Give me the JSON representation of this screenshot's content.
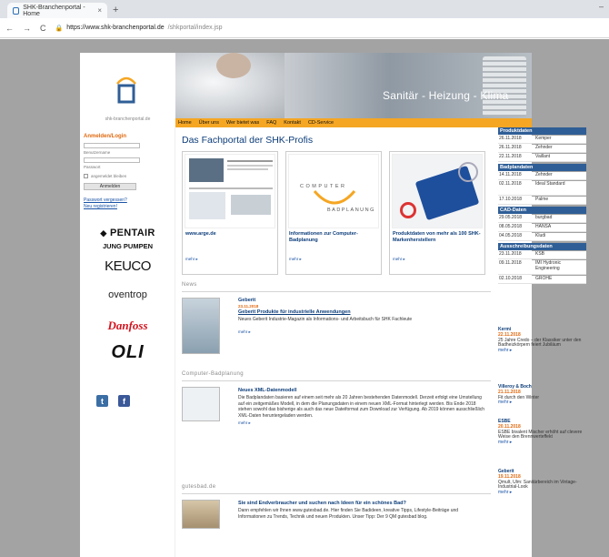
{
  "browser": {
    "tab_title": "SHK-Branchenportal - Home",
    "tab_close": "×",
    "new_tab": "+",
    "url_host": "https://www.shk-branchenportal.de",
    "url_path": "/shkportal/index.jsp",
    "window_controls": "–"
  },
  "site": {
    "logo_text": "shk-branchenportal.de",
    "banner_text": "Sanitär - Heizung - Klima",
    "nav": [
      "Home",
      "Über uns",
      "Wer bietet was",
      "FAQ",
      "Kontakt",
      "CD-Service"
    ]
  },
  "login": {
    "title": "Anmelden/Login",
    "username_label": "Benutzername",
    "password_label": "Passwort",
    "remember_label": "angemeldet bleiben",
    "button": "Anmelden",
    "forgot": "Passwort vergessen?",
    "register": "Neu registrieren!"
  },
  "brands": {
    "pentair": "PENTAIR",
    "jung": "JUNG PUMPEN",
    "keuco": "KEUCO",
    "oventrop": "oventrop",
    "danfoss": "Danfoss",
    "oli": "OLI"
  },
  "social": {
    "tumblr": "t",
    "facebook": "f"
  },
  "main": {
    "title": "Das Fachportal der SHK-Profis",
    "cards": [
      {
        "title": "www.arge.de",
        "more": "mehr ▸"
      },
      {
        "title": "Informationen zur Computer-Badplanung",
        "more": "mehr ▸",
        "logo_top": "COMPUTER",
        "logo_bottom": "BADPLANUNG"
      },
      {
        "title": "Produktdaten von mehr als 100 SHK-Markenherstellern",
        "more": "mehr ▸"
      }
    ],
    "sections": {
      "news": "News",
      "computer": "Computer-Badplanung",
      "gutesbad": "gutesbad.de"
    },
    "news1": {
      "head": "Geberit",
      "date": "23.11.2018",
      "title": "Geberit Produkte für industrielle Anwendungen",
      "text": "Neues Geberit Industrie-Magazin als Informations- und Arbeitsbuch für SHK Fachleute",
      "more": "mehr ▸"
    },
    "news2": {
      "title": "Neues XML-Datenmodell",
      "text": "Die Badplandaten basieren auf einem seit mehr als 20 Jahren bestehenden Datenmodell. Derzeit erfolgt eine Umstellung auf ein zeitgemäßes Modell, in dem die Planungsdaten in einem neuen XML-Format hinterlegt werden. Bis Ende 2018 stehen sowohl das bisherige als auch das neue Dateiformat zum Download zur Verfügung. Ab 2019 können ausschließlich XML-Daten heruntergeladen werden.",
      "more": "mehr ▸"
    },
    "news3": {
      "title": "Sie sind Endverbraucher und suchen nach Ideen für ein schönes Bad?",
      "text": "Dann empfehlen wir Ihnen www.gutesbad.de. Hier finden Sie Badideen, kreative Tipps, Lifestyle-Beiträge und Informationen zu Trends, Technik und neuen Produkten. Unser Tipp: Der 9 QM gutesbad blog."
    }
  },
  "right": {
    "produktdaten": {
      "title": "Produktdaten",
      "rows": [
        {
          "date": "26.11.2018",
          "name": "Kemper"
        },
        {
          "date": "26.11.2018",
          "name": "Zehnder"
        },
        {
          "date": "22.11.2018",
          "name": "Vaillant"
        }
      ]
    },
    "badplandaten": {
      "title": "Badplandaten",
      "rows": [
        {
          "date": "14.11.2018",
          "name": "Zehnder"
        },
        {
          "date": "02.11.2018",
          "name": "Ideal Standard"
        },
        {
          "date": "17.10.2018",
          "name": "Palme"
        }
      ]
    },
    "cad": {
      "title": "CAD-Daten",
      "rows": [
        {
          "date": "29.05.2018",
          "name": "burgbad"
        },
        {
          "date": "08.05.2018",
          "name": "HANSA"
        },
        {
          "date": "04.05.2018",
          "name": "Kludi"
        }
      ]
    },
    "ausschreibung": {
      "title": "Ausschreibungsdaten",
      "rows": [
        {
          "date": "23.11.2018",
          "name": "KSB"
        },
        {
          "date": "09.11.2018",
          "name": "IMI Hydronic Engineering"
        },
        {
          "date": "02.10.2018",
          "name": "GROHE"
        }
      ]
    },
    "news": [
      {
        "head": "Kermi",
        "date": "22.11.2018",
        "text": "25 Jahre Credo – der Klassiker unter den Badheizkörpern feiert Jubiläum",
        "more": "mehr ▸"
      },
      {
        "head": "Villeroy & Boch",
        "date": "21.11.2018",
        "text": "Fit durch den Winter",
        "more": "mehr ▸"
      },
      {
        "head": "ESBE",
        "date": "20.11.2018",
        "text": "ESBE bivalent Mischer erhöht auf clevere Weise den Brennwerteffekt",
        "more": "mehr ▸"
      },
      {
        "head": "Geberit",
        "date": "19.11.2018",
        "text": "Qmult, Ulm: Sanitärbereich im Vintage-Industrial-Look",
        "more": "mehr ▸"
      }
    ]
  }
}
